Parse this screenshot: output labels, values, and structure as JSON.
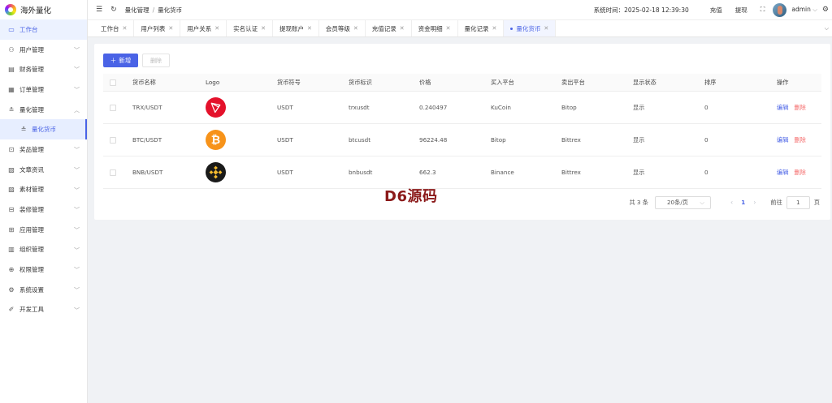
{
  "app": {
    "name": "海外量化"
  },
  "sidebar": {
    "items": [
      {
        "label": "工作台",
        "icon": "monitor-icon",
        "active": true
      },
      {
        "label": "用户管理",
        "icon": "user-icon"
      },
      {
        "label": "财务管理",
        "icon": "finance-chart-icon"
      },
      {
        "label": "订单管理",
        "icon": "order-icon"
      },
      {
        "label": "量化管理",
        "icon": "quant-icon",
        "expanded": true
      },
      {
        "label": "量化货币",
        "icon": "coin-sub-icon",
        "sub": true
      },
      {
        "label": "奖品管理",
        "icon": "gift-icon"
      },
      {
        "label": "文章资讯",
        "icon": "article-icon"
      },
      {
        "label": "素材管理",
        "icon": "image-icon"
      },
      {
        "label": "装修管理",
        "icon": "decor-icon"
      },
      {
        "label": "应用管理",
        "icon": "app-icon"
      },
      {
        "label": "组织管理",
        "icon": "org-icon"
      },
      {
        "label": "权限管理",
        "icon": "lock-icon"
      },
      {
        "label": "系统设置",
        "icon": "gear-icon"
      },
      {
        "label": "开发工具",
        "icon": "dev-tool-icon"
      }
    ]
  },
  "header": {
    "breadcrumb": [
      "量化管理",
      "量化货币"
    ],
    "sys_time": "系统时间：2025-02-18 12:39:30",
    "recharge": "充值",
    "withdraw": "提现",
    "user": "admin"
  },
  "tabs": [
    {
      "label": "工作台"
    },
    {
      "label": "用户列表"
    },
    {
      "label": "用户关系"
    },
    {
      "label": "实名认证"
    },
    {
      "label": "提现账户"
    },
    {
      "label": "会员等级"
    },
    {
      "label": "充值记录"
    },
    {
      "label": "资金明细"
    },
    {
      "label": "量化记录"
    },
    {
      "label": "量化货币",
      "active": true
    }
  ],
  "toolbar": {
    "add_label": "新增",
    "delete_label": "删除"
  },
  "table": {
    "columns": [
      "货币名称",
      "Logo",
      "货币符号",
      "货币标识",
      "价格",
      "买入平台",
      "卖出平台",
      "显示状态",
      "排序",
      "操作"
    ],
    "rows": [
      {
        "name": "TRX/USDT",
        "logo": "trx",
        "symbol": "USDT",
        "code": "trxusdt",
        "price": "0.240497",
        "buy": "KuCoin",
        "sell": "Bitop",
        "status": "显示",
        "sort": "0"
      },
      {
        "name": "BTC/USDT",
        "logo": "btc",
        "symbol": "USDT",
        "code": "btcusdt",
        "price": "96224.48",
        "buy": "Bitop",
        "sell": "Bittrex",
        "status": "显示",
        "sort": "0"
      },
      {
        "name": "BNB/USDT",
        "logo": "bnb",
        "symbol": "USDT",
        "code": "bnbusdt",
        "price": "662.3",
        "buy": "Binance",
        "sell": "Bittrex",
        "status": "显示",
        "sort": "0"
      }
    ],
    "edit_label": "编辑",
    "delete_label": "删除",
    "btc_glyph": "₿"
  },
  "pagination": {
    "total": "共 3 条",
    "page_size": "20条/页",
    "current": "1",
    "goto_label": "前往",
    "goto_value": "1",
    "page_unit": "页"
  },
  "watermark": "D6源码",
  "colors": {
    "primary": "#4a63e6",
    "danger": "#f56c6c",
    "trx": "#e4112b",
    "btc": "#f7931a",
    "bnb": "#1a1a1a",
    "bnb_gold": "#f3ba2f"
  }
}
